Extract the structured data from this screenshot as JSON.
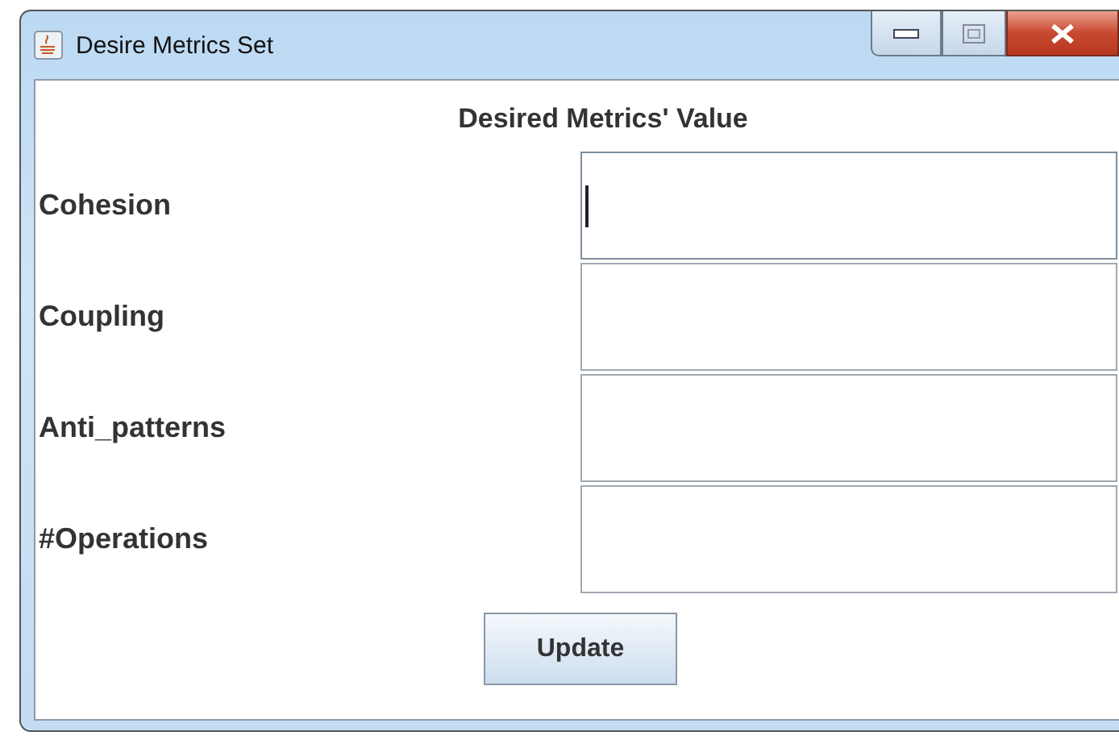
{
  "window": {
    "title": "Desire Metrics Set"
  },
  "heading": "Desired Metrics' Value",
  "fields": [
    {
      "label": "Cohesion",
      "focused": true
    },
    {
      "label": "Coupling",
      "focused": false
    },
    {
      "label": "Anti_patterns",
      "focused": false
    },
    {
      "label": "#Operations",
      "focused": false
    }
  ],
  "buttons": [
    "Update"
  ]
}
